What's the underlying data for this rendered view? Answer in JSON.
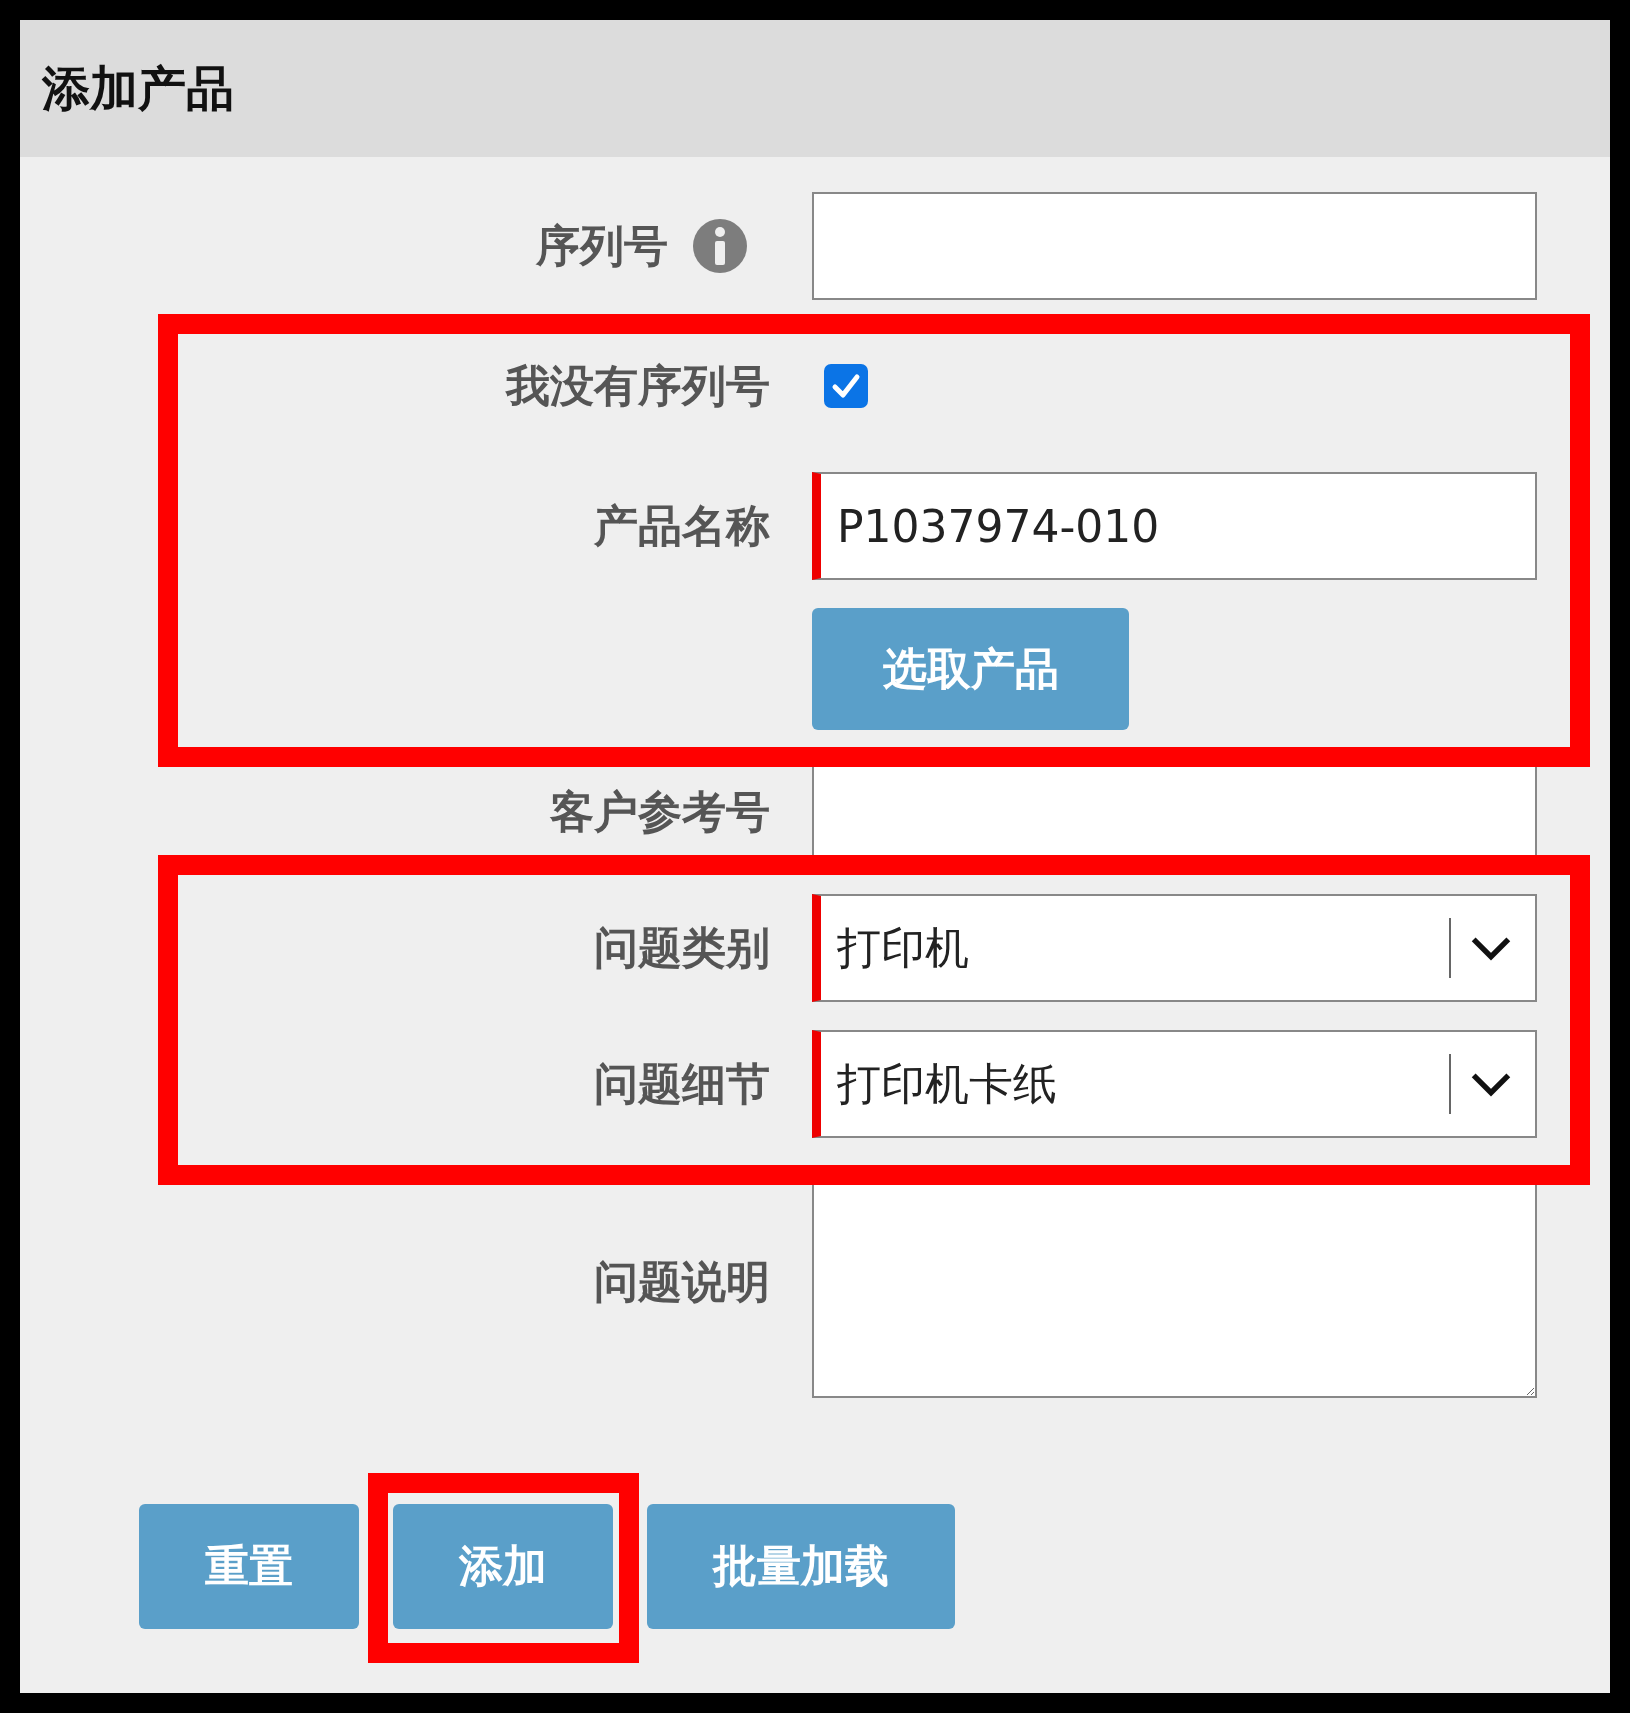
{
  "panel": {
    "title": "添加产品"
  },
  "fields": [
    {
      "kind": "text",
      "label": "序列号",
      "info": true,
      "required": false
    },
    {
      "kind": "checkbox",
      "label": "我没有序列号",
      "checked": true
    },
    {
      "kind": "text",
      "label": "产品名称",
      "value": "P1037974-010",
      "required": true
    },
    {
      "kind": "button",
      "text": "选取产品"
    },
    {
      "kind": "text",
      "label": "客户参考号",
      "required": false
    },
    {
      "kind": "select",
      "label": "问题类别",
      "value": "打印机",
      "required": true
    },
    {
      "kind": "select",
      "label": "问题细节",
      "value": "打印机卡纸",
      "required": true
    },
    {
      "kind": "textarea",
      "label": "问题说明",
      "required": false
    }
  ],
  "buttons": [
    "重置",
    "添加",
    "批量加载"
  ]
}
